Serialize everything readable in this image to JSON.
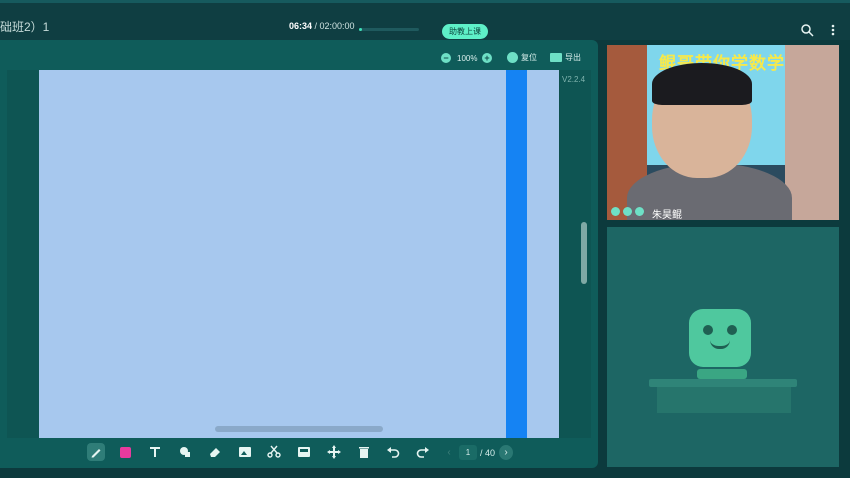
{
  "header": {
    "title": "础班2）1",
    "time_current": "06:34",
    "time_total": " / 02:00:00",
    "progress_fraction": 0.055,
    "assist_label": "助教上课",
    "icons": [
      "search-zoom-icon",
      "more-vertical-icon"
    ]
  },
  "board": {
    "zoom_out_symbol": "−",
    "zoom_in_symbol": "+",
    "zoom_value": "100%",
    "reset_label": "复位",
    "export_label": "导出",
    "version": "V2.2.4"
  },
  "toolbar": {
    "tools": [
      "pen-icon",
      "color-swatch",
      "text-icon",
      "shape-icon",
      "eraser-icon",
      "image-icon",
      "scissors-icon",
      "screen-icon",
      "move-icon",
      "trash-icon",
      "undo-icon",
      "redo-icon"
    ],
    "current_page": "1",
    "total_pages": "/ 40",
    "prev_symbol": "‹",
    "next_symbol": "›",
    "swatch_color": "#e83a9e"
  },
  "video": {
    "banner": "鲲哥带你学数学",
    "teacher_name": "朱昊鲲"
  },
  "colors": {
    "accent": "#5ef0c8",
    "page": "#a7c8ee",
    "stripe": "#1583f3"
  }
}
